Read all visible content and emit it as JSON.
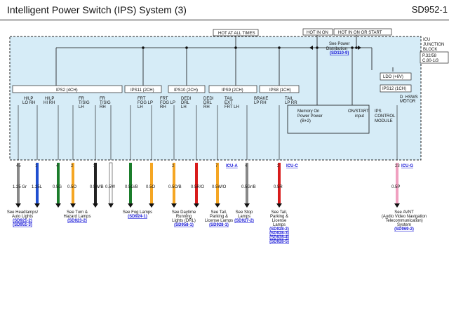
{
  "header": {
    "title": "Intelligent Power Switch (IPS) System (3)",
    "code": "SD952-1"
  },
  "top_labels": {
    "hot_at_all_times": "HOT AT ALL TIMES",
    "hot_in_on": "HOT IN ON",
    "hot_in_on_or_start": "HOT IN ON OR START"
  },
  "block": {
    "name_lines": [
      "ICU",
      "JUNCTION",
      "BLOCK"
    ],
    "ref_lines": [
      "P.32/58",
      "C.80-1/3"
    ],
    "ldo": "LDO (+6V)",
    "see_power_dist": "See Power",
    "see_power_dist2": "Distribution",
    "see_power_dist_link": "(SD110-9)",
    "memory_power": [
      "Memory  On",
      "Power  Power",
      "(B+2)"
    ],
    "on_start_input": [
      "ON/START",
      "input"
    ],
    "control_module": [
      "IPS",
      "CONTROL",
      "MODULE"
    ]
  },
  "ips": [
    {
      "name": "IPS2 (4CH)",
      "channels": [
        [
          "H/LP",
          "LO RH"
        ],
        [
          "H/LP",
          "HI RH"
        ],
        [
          "FR",
          "T/SIG",
          "LH"
        ],
        [
          "FR",
          "T/SIG",
          "RH"
        ]
      ]
    },
    {
      "name": "IPS11 (2CH)",
      "channels": [
        [
          "FRT",
          "FOG LP",
          "LH"
        ],
        [
          "FRT",
          "FOG LP",
          "RH"
        ]
      ]
    },
    {
      "name": "IPS10 (2CH)",
      "channels": [
        [
          "DEDI",
          "DRL",
          "LH"
        ],
        [
          "DEDI",
          "DRL",
          "RH"
        ]
      ]
    },
    {
      "name": "IPS9 (2CH)",
      "channels": [
        [
          "TAIL",
          "EXT",
          "FRT LH"
        ],
        [
          "BRAKE",
          "LP RH"
        ]
      ]
    },
    {
      "name": "IPS8 (1CH)",
      "channels": [
        [
          "TAIL",
          "LP RR"
        ]
      ]
    },
    {
      "name": "IPS12 (1CH)",
      "channels": [
        [
          "D_HSWS",
          "MOTOR"
        ]
      ]
    }
  ],
  "connectors": [
    "ICU-A",
    "ICU-C",
    "ICU-G"
  ],
  "wires": [
    {
      "pin": "45",
      "spec": "1.25 Gr",
      "color": "#888888"
    },
    {
      "pin": "1",
      "spec": "1.25L",
      "color": "#1f4fd0"
    },
    {
      "pin": "4",
      "spec": "0.5G",
      "color": "#1b7d2b"
    },
    {
      "pin": "2",
      "spec": "0.5O",
      "color": "#f5a623"
    },
    {
      "pin": "3",
      "spec": "0.5W/B",
      "color": "#222222"
    },
    {
      "pin": "",
      "spec": "0.5W",
      "color": "#ffffff"
    },
    {
      "pin": "",
      "spec": "0.5G/B",
      "color": "#1b7d2b"
    },
    {
      "pin": "",
      "spec": "0.5O",
      "color": "#f5a623"
    },
    {
      "pin": "2",
      "spec": "0.5O/B",
      "color": "#f5a623"
    },
    {
      "pin": "",
      "spec": "0.5R/O",
      "color": "#d81b1b"
    },
    {
      "pin": "7",
      "spec": "0.5W/O",
      "color": "#f5a623"
    },
    {
      "pin": "4",
      "spec": "0.5Gr/B",
      "color": "#888888"
    },
    {
      "pin": "2",
      "spec": "0.5R",
      "color": "#d81b1b"
    },
    {
      "pin": "23",
      "spec": "0.5P",
      "color": "#f0a0c0"
    }
  ],
  "destinations": [
    {
      "lines": [
        "See Headlamps/",
        "Auto Lights"
      ],
      "links": [
        "(SD921-2)",
        "(SD951-3)"
      ]
    },
    {
      "lines": [
        "See Turn &",
        "Hazard Lamps"
      ],
      "links": [
        "(SD923-2)"
      ]
    },
    {
      "lines": [
        "See Fog Lamps"
      ],
      "links": [
        "(SD924-1)"
      ]
    },
    {
      "lines": [
        "See Daytime",
        "Running",
        "Lights (DRL)"
      ],
      "links": [
        "(SD958-1)"
      ]
    },
    {
      "lines": [
        "See Tail,",
        "Parking &",
        "License Lamps"
      ],
      "links": [
        "(SD928-1)"
      ]
    },
    {
      "lines": [
        "See Stop",
        "Lamps"
      ],
      "links": [
        "(SD927-2)"
      ]
    },
    {
      "lines": [
        "See Tail,",
        "Parking &",
        "License",
        "Lamps"
      ],
      "links": [
        "(SD928-2)",
        "(SD928-3)",
        "(SD928-4)",
        "(SD928-5)"
      ]
    },
    {
      "lines": [
        "See AVNT",
        "(Audio Video Navigation",
        "Telecommunication)",
        "System"
      ],
      "links": [
        "(SD969-2)"
      ]
    }
  ]
}
